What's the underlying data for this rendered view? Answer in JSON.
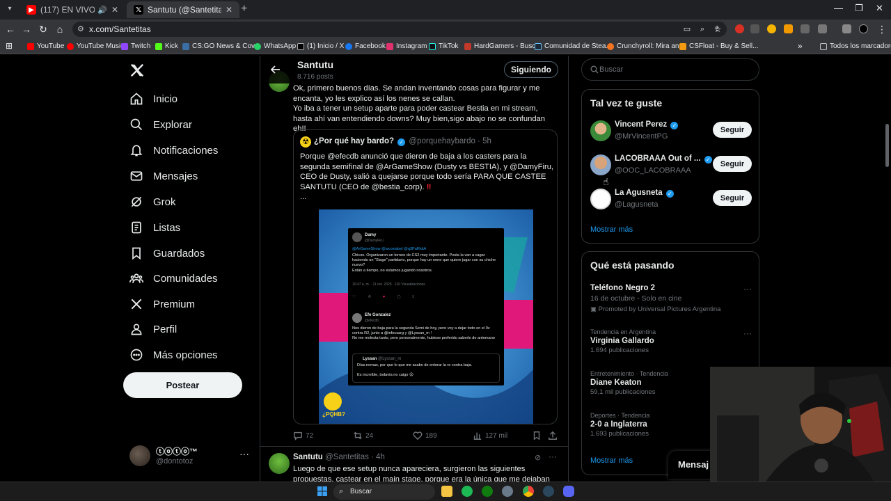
{
  "browser": {
    "tabs": [
      {
        "title": "(117) EN VIVO | FÓRMULA 1 GP",
        "active": false
      },
      {
        "title": "Santutu (@Santetitas) / X",
        "active": true
      }
    ],
    "url": "x.com/Santetitas",
    "bookmarks": [
      "YouTube",
      "YouTube Music",
      "Twitch",
      "Kick",
      "CS:GO News & Cov...",
      "WhatsApp",
      "(1) Inicio / X",
      "Facebook",
      "Instagram",
      "TikTok",
      "HardGamers - Busc...",
      "Comunidad de Stea...",
      "Crunchyroll: Mira an...",
      "CSFloat - Buy & Sell..."
    ],
    "all_bookmarks": "Todos los marcadores"
  },
  "nav": {
    "items": [
      "Inicio",
      "Explorar",
      "Notificaciones",
      "Mensajes",
      "Grok",
      "Listas",
      "Guardados",
      "Comunidades",
      "Premium",
      "Perfil",
      "Más opciones"
    ],
    "post_button": "Postear",
    "account_name": "ⓣⓞⓣⓞ™",
    "account_handle": "@dontotoz"
  },
  "profile_header": {
    "name": "Santutu",
    "posts": "8.716 posts",
    "follow_state": "Siguiendo"
  },
  "tweet1": {
    "text": "Ok, primero buenos días. Se andan inventando cosas para figurar y me encanta, yo les explico así los nenes se callan.\nYo iba a tener un setup aparte para poder castear Bestia en mi stream, hasta ahí van entendiendo downs? Muy bien,sigo abajo no se confundan eh!!",
    "quote": {
      "name": "¿Por qué hay bardo?",
      "handle": "@porquehaybardo · 5h",
      "body": "Porque @efecdb anunció que dieron de baja a los casters para la segunda semifinal de @ArGameShow (Dusty vs BESTIA), y @DamyFiru, CEO de Dusty, salió a quejarse porque todo sería PARA QUE CASTEE SANTUTU (CEO de @bestia_corp).",
      "ellipsis": "...",
      "media": {
        "post1_name": "Damy",
        "post1_handle": "@DamyFiru",
        "post1_mentions": "@ArGameShow @wcostabel @q3PaRkitA",
        "post1_text": "Chicos. Organizaron un torneo de CS2 muy importante. Posta la van a cagar haciendo un \"Stage\" partidario, porque hay un nene que quiere jugar con su chiche nuevo?\nEstán a tiempo, no estamos jugando nosotros.",
        "post1_meta": "10:47 a. m. · 11 oct. 2025 · 110 Visualizaciones",
        "post2_name": "Efe Gonzalez",
        "post2_handle": "@efecdb",
        "post2_text": "Nos dieron de baja para la segunda Semi de hoy, pero voy a dejar todo en el 9z contra R2, junto a @infocsarg y @Lyssan_m !\nNo me molesta tanto, pero personalmente, hubiese preferido saberlo de antemano",
        "reply_name": "Lyssan",
        "reply_handle": "@Lyssan_m",
        "reply_text": "Días nomas, por que lo que me acabo de enterar la re contra baja.",
        "reply_text2": "Es increíble, todavía no caigo 😮",
        "logo_text": "¿PQHB?"
      }
    },
    "stats": {
      "replies": "72",
      "retweets": "24",
      "likes": "189",
      "views": "127 mil"
    }
  },
  "tweet2": {
    "name": "Santutu",
    "handle": "@Santetitas · 4h",
    "text": "Luego de que ese setup nunca apareciera, surgieron las siguientes propuestas, castear en el main stage, porque era la única que me dejaban hacer, no había"
  },
  "sidebar": {
    "search_placeholder": "Buscar",
    "who_title": "Tal vez te guste",
    "who": [
      {
        "name": "Vincent Perez",
        "handle": "@MrVincentPG",
        "button": "Seguir"
      },
      {
        "name": "LACOBRAAA Out of ...",
        "handle": "@OOC_LACOBRAAA",
        "button": "Seguir"
      },
      {
        "name": "La Agusneta",
        "handle": "@Lagusneta",
        "button": "Seguir"
      }
    ],
    "who_more": "Mostrar más",
    "trends_title": "Qué está pasando",
    "promo": {
      "name": "Teléfono Negro 2",
      "sub": "16 de octubre - Solo en cine",
      "promoted": "Promoted by Universal Pictures Argentina"
    },
    "trends": [
      {
        "category": "Tendencia en Argentina",
        "name": "Virginia Gallardo",
        "count": "1.694 publicaciones"
      },
      {
        "category": "Entretenimiento · Tendencia",
        "name": "Diane Keaton",
        "count": "59,1 mil publicaciones"
      },
      {
        "category": "Deportes · Tendencia",
        "name": "2-0 a Inglaterra",
        "count": "1.693 publicaciones"
      }
    ],
    "trends_more": "Mostrar más"
  },
  "messages_tab": "Mensaj",
  "taskbar": {
    "search": "Buscar"
  },
  "colors": {
    "accent": "#1d9bf0",
    "background": "#000000",
    "border": "#2f3336",
    "muted": "#71767b"
  }
}
